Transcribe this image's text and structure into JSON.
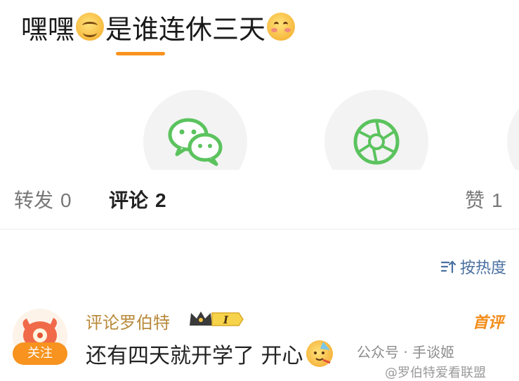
{
  "post": {
    "text_part1": "嘿嘿",
    "text_part2": "是谁连休三天",
    "emoji_1": "grinning-face-emoji",
    "emoji_2": "smiling-blushing-face-emoji"
  },
  "share": {
    "icons": [
      "wechat-icon",
      "moments-icon"
    ]
  },
  "tabs": [
    {
      "label": "转发",
      "count": "0"
    },
    {
      "label": "评论",
      "count": "2"
    },
    {
      "label": "赞",
      "count": "1"
    }
  ],
  "sort": {
    "label": "按热度",
    "icon": "sort-icon"
  },
  "comment": {
    "username": "评论罗伯特",
    "badge_level": "I",
    "follow_label": "关注",
    "first_tag": "首评",
    "text": "还有四天就开学了 开心",
    "emoji": "partying-face-emoji"
  },
  "watermark": {
    "line1": "公众号 · 手谈姬",
    "line2": "@罗伯特爱看联盟"
  },
  "colors": {
    "accent": "#f7931e",
    "username": "#b88a3a",
    "sort": "#4a6fa0",
    "wechat_green": "#5bc35e"
  }
}
